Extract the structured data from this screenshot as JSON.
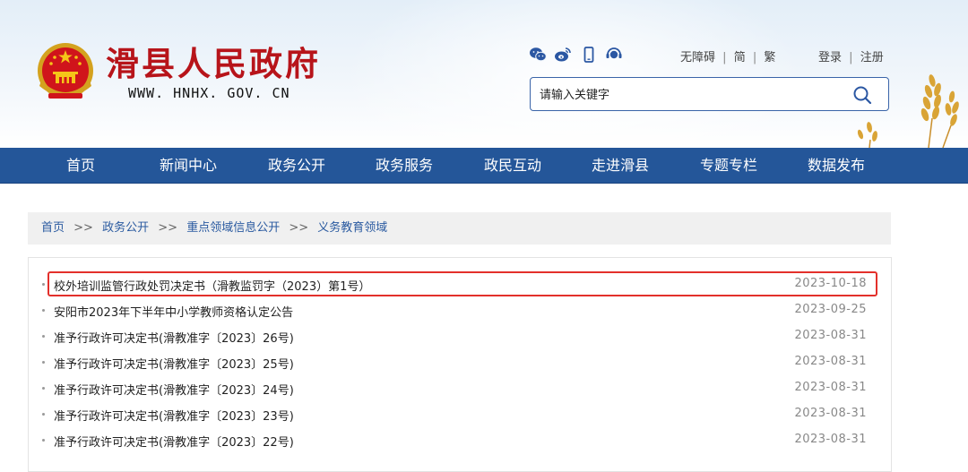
{
  "site": {
    "title": "滑县人民政府",
    "url": "WWW. HNHX. GOV. CN"
  },
  "header": {
    "social_icons": [
      "wechat-icon",
      "weibo-icon",
      "mobile-icon",
      "app-icon"
    ],
    "tools": {
      "accessibility": "无障碍",
      "simplified": "简",
      "traditional": "繁",
      "separator": "|"
    },
    "auth": {
      "login": "登录",
      "register": "注册",
      "separator": "|"
    },
    "search": {
      "placeholder": "请输入关键字",
      "button_icon": "search-icon"
    }
  },
  "nav": {
    "items": [
      "首页",
      "新闻中心",
      "政务公开",
      "政务服务",
      "政民互动",
      "走进滑县",
      "专题专栏",
      "数据发布"
    ]
  },
  "breadcrumb": {
    "items": [
      "首页",
      "政务公开",
      "重点领域信息公开",
      "义务教育领域"
    ],
    "separator": ">>"
  },
  "list": {
    "items": [
      {
        "title": "校外培训监管行政处罚决定书（滑教监罚字（2023）第1号）",
        "date": "2023-10-18",
        "highlighted": true
      },
      {
        "title": "安阳市2023年下半年中小学教师资格认定公告",
        "date": "2023-09-25"
      },
      {
        "title": "准予行政许可决定书(滑教准字〔2023〕26号)",
        "date": "2023-08-31"
      },
      {
        "title": "准予行政许可决定书(滑教准字〔2023〕25号)",
        "date": "2023-08-31"
      },
      {
        "title": "准予行政许可决定书(滑教准字〔2023〕24号)",
        "date": "2023-08-31"
      },
      {
        "title": "准予行政许可决定书(滑教准字〔2023〕23号)",
        "date": "2023-08-31"
      },
      {
        "title": "准予行政许可决定书(滑教准字〔2023〕22号)",
        "date": "2023-08-31"
      }
    ]
  },
  "colors": {
    "brand_red": "#b7141a",
    "nav_blue": "#245699",
    "link_blue": "#2a5aa0",
    "highlight_red": "#e3302b"
  }
}
